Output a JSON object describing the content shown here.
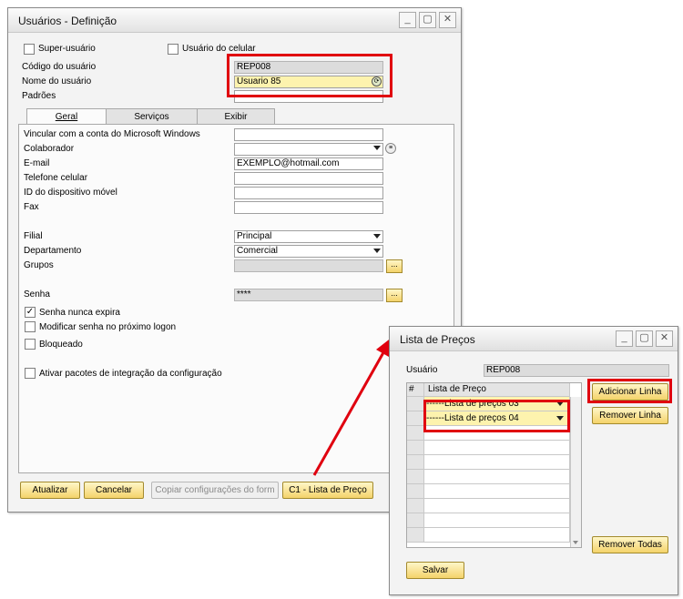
{
  "main_window": {
    "title": "Usuários - Definição",
    "minimize": "_",
    "maximize": "▢",
    "close": "✕",
    "superuser_label": "Super-usuário",
    "mobile_user_label": "Usuário do celular",
    "user_code_label": "Código do usuário",
    "user_code_value": "REP008",
    "user_name_label": "Nome do usuário",
    "user_name_value": "Usuario 85",
    "defaults_label": "Padrões",
    "defaults_value": "",
    "tabs": [
      {
        "label": "Geral",
        "active": true
      },
      {
        "label": "Serviços",
        "active": false
      },
      {
        "label": "Exibir",
        "active": false
      }
    ],
    "fields": {
      "windows_account_label": "Vincular com a conta do Microsoft Windows",
      "windows_account_value": "",
      "employee_label": "Colaborador",
      "employee_value": "",
      "email_label": "E-mail",
      "email_value": "EXEMPLO@hotmail.com",
      "mobile_phone_label": "Telefone celular",
      "mobile_phone_value": "",
      "mobile_device_label": "ID do dispositivo móvel",
      "mobile_device_value": "",
      "fax_label": "Fax",
      "fax_value": "",
      "branch_label": "Filial",
      "branch_value": "Principal",
      "department_label": "Departamento",
      "department_value": "Comercial",
      "groups_label": "Grupos",
      "groups_value": "",
      "password_label": "Senha",
      "password_value": "****",
      "ellipsis": "..."
    },
    "checkboxes": {
      "never_expires": "Senha nunca expira",
      "change_next_logon": "Modificar senha no próximo logon",
      "locked": "Bloqueado",
      "activate_packages": "Ativar pacotes de integração da configuração"
    },
    "buttons": {
      "update": "Atualizar",
      "cancel": "Cancelar",
      "copy_settings": "Copiar configurações do form",
      "price_list": "C1 - Lista de Preço"
    }
  },
  "price_window": {
    "title": "Lista de Preços",
    "minimize": "_",
    "maximize": "▢",
    "close": "✕",
    "user_label": "Usuário",
    "user_value": "REP008",
    "grid_header_num": "#",
    "grid_header_list": "Lista de Preço",
    "rows": [
      "------Lista de preços 03",
      "------Lista de preços 04",
      "",
      "",
      "",
      "",
      "",
      "",
      "",
      ""
    ],
    "buttons": {
      "add_line": "Adicionar Linha",
      "remove_line": "Remover Linha",
      "remove_all": "Remover Todas",
      "save": "Salvar"
    }
  },
  "colors": {
    "highlight_red": "#e0000f",
    "yellow_field": "#fdf3ae",
    "button_gold": "#f4d36a"
  }
}
